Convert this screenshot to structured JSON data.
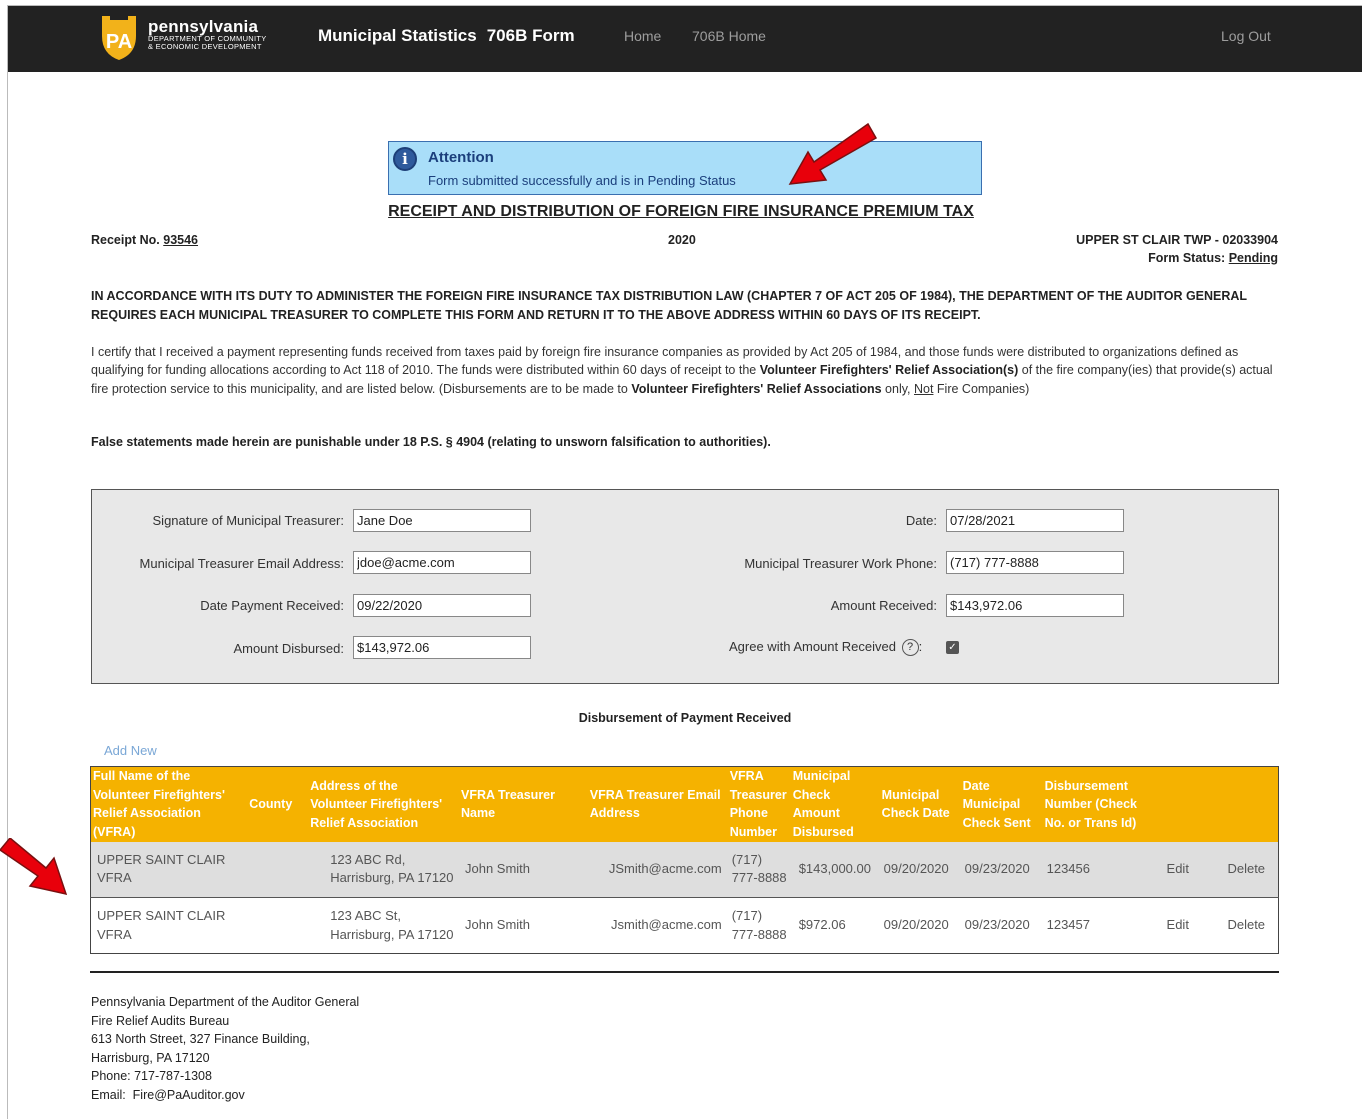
{
  "nav": {
    "logo_main": "pennsylvania",
    "logo_sub_1": "DEPARTMENT OF COMMUNITY",
    "logo_sub_2": "& ECONOMIC DEVELOPMENT",
    "logo_badge": "PA",
    "app_title": "Municipal Statistics",
    "form_title": "706B Form",
    "links": [
      "Home",
      "706B Home"
    ],
    "logout": "Log Out"
  },
  "alert": {
    "title": "Attention",
    "message": "Form submitted successfully and is in Pending Status"
  },
  "heading": "RECEIPT AND DISTRIBUTION OF FOREIGN FIRE INSURANCE PREMIUM TAX",
  "receipt": {
    "label": "Receipt No.",
    "number": "93546"
  },
  "year": "2020",
  "municipality": "UPPER ST CLAIR TWP - 02033904",
  "status": {
    "label": "Form Status:",
    "value": "Pending"
  },
  "duty_text": "IN ACCORDANCE WITH ITS DUTY TO ADMINISTER THE FOREIGN FIRE INSURANCE TAX DISTRIBUTION LAW (CHAPTER 7 OF ACT 205 OF 1984), THE DEPARTMENT OF THE AUDITOR GENERAL REQUIRES EACH MUNICIPAL TREASURER TO COMPLETE THIS FORM AND RETURN IT TO THE ABOVE ADDRESS WITHIN 60 DAYS OF ITS RECEIPT.",
  "certify": {
    "part1": "I certify that I received a payment representing funds received from taxes paid by foreign fire insurance companies as provided by Act 205 of 1984, and those funds were distributed to organizations defined as qualifying for funding allocations according to Act 118 of 2010. The funds were distributed within 60 days of receipt to the ",
    "bold1": "Volunteer Firefighters' Relief Association(s)",
    "part2": " of the fire company(ies) that provide(s) actual fire protection service to this municipality, and are listed below. (Disbursements are to be made to ",
    "bold2": "Volunteer Firefighters' Relief Associations",
    "part3": " only, ",
    "underline": "Not",
    "part4": " Fire Companies)"
  },
  "false_statement": "False statements made herein are punishable under 18 P.S. § 4904 (relating to unsworn falsification to authorities).",
  "form": {
    "signature_label": "Signature of Municipal Treasurer:",
    "signature_value": "Jane Doe",
    "date_label": "Date:",
    "date_value": "07/28/2021",
    "email_label": "Municipal Treasurer Email Address:",
    "email_value": "jdoe@acme.com",
    "phone_label": "Municipal Treasurer Work Phone:",
    "phone_value": "(717) 777-8888",
    "date_received_label": "Date Payment Received:",
    "date_received_value": "09/22/2020",
    "amount_received_label": "Amount Received:",
    "amount_received_value": "$143,972.06",
    "amount_disbursed_label": "Amount Disbursed:",
    "amount_disbursed_value": "$143,972.06",
    "agree_label": "Agree with Amount Received",
    "agree_help": "?",
    "agree_checked": true
  },
  "disbursement": {
    "title": "Disbursement of Payment Received",
    "add_new": "Add New",
    "columns": [
      "Full Name of the Volunteer Firefighters' Relief Association (VFRA)",
      "County",
      "Address of the Volunteer Firefighters' Relief Association",
      "VFRA Treasurer Name",
      "VFRA Treasurer Email Address",
      "VFRA Treasurer Phone Number",
      "Municipal Check Amount Disbursed",
      "Municipal Check Date",
      "Date Municipal Check Sent",
      "Disbursement Number (Check No. or Trans Id)"
    ],
    "rows": [
      {
        "name": "UPPER SAINT CLAIR VFRA",
        "county": "",
        "address": "123 ABC Rd, Harrisburg, PA 17120",
        "treasurer": "John Smith",
        "email": "JSmith@acme.com",
        "phone": "(717) 777-8888",
        "amount": "$143,000.00",
        "check_date": "09/20/2020",
        "sent_date": "09/23/2020",
        "number": "123456",
        "edit": "Edit",
        "delete": "Delete"
      },
      {
        "name": "UPPER SAINT CLAIR VFRA",
        "county": "",
        "address": "123 ABC St, Harrisburg, PA 17120",
        "treasurer": "John Smith",
        "email": "Jsmith@acme.com",
        "phone": "(717) 777-8888",
        "amount": "$972.06",
        "check_date": "09/20/2020",
        "sent_date": "09/23/2020",
        "number": "123457",
        "edit": "Edit",
        "delete": "Delete"
      }
    ]
  },
  "footer": [
    "Pennsylvania Department of the Auditor General",
    "Fire Relief Audits Bureau",
    "613 North Street, 327 Finance Building,",
    "Harrisburg, PA 17120",
    "Phone: 717-787-1308",
    "Email:  Fire@PaAuditor.gov"
  ],
  "colors": {
    "navbar": "#222222",
    "table_header": "#f5b200",
    "alert_bg": "#a9def9",
    "annotation_arrow": "#e8000b",
    "link": "#7aa7d6"
  }
}
